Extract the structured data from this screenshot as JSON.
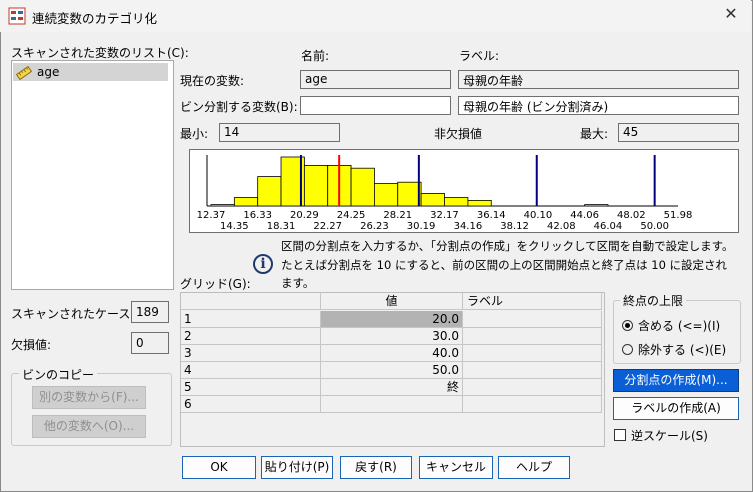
{
  "window": {
    "title": "連続変数のカテゴリ化",
    "close_glyph": "✕"
  },
  "scanned_list": {
    "label": "スキャンされた変数のリスト(C):",
    "items": [
      {
        "name": "age",
        "icon": "ruler-icon"
      }
    ]
  },
  "headers": {
    "name": "名前:",
    "label": "ラベル:"
  },
  "current_var": {
    "label": "現在の変数:",
    "name": "age",
    "var_label": "母親の年齢"
  },
  "binned_var": {
    "label": "ビン分割する変数(B):",
    "name": "",
    "var_label": "母親の年齢 (ビン分割済み)"
  },
  "stats": {
    "min_label": "最小:",
    "min_value": "14",
    "nonmissing_label": "非欠損値",
    "max_label": "最大:",
    "max_value": "45"
  },
  "scanned_cases": {
    "label": "スキャンされたケース:",
    "value": "189"
  },
  "missing": {
    "label": "欠損値:",
    "value": "0"
  },
  "copy_bins": {
    "label": "ビンのコピー",
    "from_button": "別の変数から(F)...",
    "to_button": "他の変数へ(O)..."
  },
  "info_text": [
    "区間の分割点を入力するか、「分割点の作成」をクリックして区間を自動で設定します。",
    "たとえば分割点を 10 にすると、前の区間の上の区間開始点と終了点は 10 に設定され",
    "ます。"
  ],
  "grid": {
    "label": "グリッド(G):",
    "headers": {
      "value": "値",
      "label": "ラベル"
    },
    "rows": [
      {
        "num": "1",
        "value": "20.0",
        "label": ""
      },
      {
        "num": "2",
        "value": "30.0",
        "label": ""
      },
      {
        "num": "3",
        "value": "40.0",
        "label": ""
      },
      {
        "num": "4",
        "value": "50.0",
        "label": ""
      },
      {
        "num": "5",
        "value": "終",
        "label": ""
      },
      {
        "num": "6",
        "value": "",
        "label": ""
      }
    ]
  },
  "upper_endpoint": {
    "label": "終点の上限",
    "include": "含める (<=)(I)",
    "exclude": "除外する (<)(E)",
    "selected": "include"
  },
  "buttons": {
    "make_cutpoints": "分割点の作成(M)...",
    "make_labels": "ラベルの作成(A)",
    "ok": "OK",
    "paste": "貼り付け(P)",
    "reset": "戻す(R)",
    "cancel": "キャンセル",
    "help": "ヘルプ"
  },
  "reverse_scale": {
    "label": "逆スケール(S)",
    "checked": false
  },
  "colors": {
    "bar_fill": "#ffff00",
    "cutpoint_line": "#000080",
    "mean_line": "#ff0000"
  },
  "chart_data": {
    "type": "bar",
    "x_tick_labels_top": [
      "12.37",
      "16.33",
      "20.29",
      "24.25",
      "28.21",
      "32.17",
      "36.14",
      "40.10",
      "44.06",
      "48.02",
      "51.98"
    ],
    "x_tick_labels_bottom": [
      "14.35",
      "18.31",
      "22.27",
      "26.23",
      "30.19",
      "34.16",
      "38.12",
      "42.08",
      "46.04",
      "50.00"
    ],
    "xlim": [
      12.37,
      51.98
    ],
    "bins": [
      {
        "x0": 12.37,
        "x1": 14.35,
        "count": 1
      },
      {
        "x0": 14.35,
        "x1": 16.33,
        "count": 6
      },
      {
        "x0": 16.33,
        "x1": 18.31,
        "count": 21
      },
      {
        "x0": 18.31,
        "x1": 20.29,
        "count": 35
      },
      {
        "x0": 20.29,
        "x1": 22.27,
        "count": 29
      },
      {
        "x0": 22.27,
        "x1": 24.25,
        "count": 29
      },
      {
        "x0": 24.25,
        "x1": 26.23,
        "count": 27
      },
      {
        "x0": 26.23,
        "x1": 28.21,
        "count": 16
      },
      {
        "x0": 28.21,
        "x1": 30.19,
        "count": 17
      },
      {
        "x0": 30.19,
        "x1": 32.17,
        "count": 9
      },
      {
        "x0": 32.17,
        "x1": 34.16,
        "count": 6
      },
      {
        "x0": 34.16,
        "x1": 36.14,
        "count": 4
      },
      {
        "x0": 36.14,
        "x1": 38.12,
        "count": 0
      },
      {
        "x0": 38.12,
        "x1": 40.1,
        "count": 0
      },
      {
        "x0": 40.1,
        "x1": 42.08,
        "count": 0
      },
      {
        "x0": 42.08,
        "x1": 44.06,
        "count": 0
      },
      {
        "x0": 44.06,
        "x1": 46.04,
        "count": 1
      },
      {
        "x0": 46.04,
        "x1": 48.02,
        "count": 0
      },
      {
        "x0": 48.02,
        "x1": 50.0,
        "count": 0
      }
    ],
    "ymax": 35,
    "mean": 23.24,
    "cutpoints": [
      20,
      30,
      40,
      50
    ]
  }
}
